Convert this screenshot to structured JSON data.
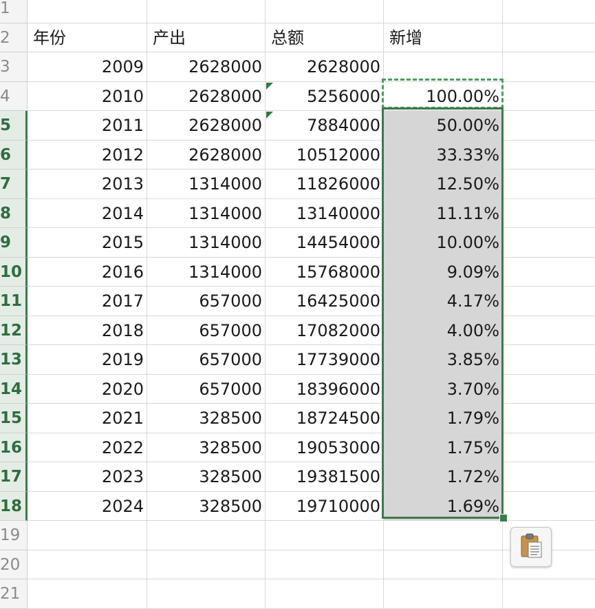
{
  "headers": [
    "年份",
    "产出",
    "总额",
    "新增"
  ],
  "rows": [
    {
      "n": "1",
      "year": "",
      "out": "",
      "total": "",
      "pct": ""
    },
    {
      "n": "2",
      "year": "年份",
      "out": "产出",
      "total": "总额",
      "pct": "新增"
    },
    {
      "n": "3",
      "year": "2009",
      "out": "2628000",
      "total": "2628000",
      "pct": ""
    },
    {
      "n": "4",
      "year": "2010",
      "out": "2628000",
      "total": "5256000",
      "pct": "100.00%"
    },
    {
      "n": "5",
      "year": "2011",
      "out": "2628000",
      "total": "7884000",
      "pct": "50.00%"
    },
    {
      "n": "6",
      "year": "2012",
      "out": "2628000",
      "total": "10512000",
      "pct": "33.33%"
    },
    {
      "n": "7",
      "year": "2013",
      "out": "1314000",
      "total": "11826000",
      "pct": "12.50%"
    },
    {
      "n": "8",
      "year": "2014",
      "out": "1314000",
      "total": "13140000",
      "pct": "11.11%"
    },
    {
      "n": "9",
      "year": "2015",
      "out": "1314000",
      "total": "14454000",
      "pct": "10.00%"
    },
    {
      "n": "10",
      "year": "2016",
      "out": "1314000",
      "total": "15768000",
      "pct": "9.09%"
    },
    {
      "n": "11",
      "year": "2017",
      "out": "657000",
      "total": "16425000",
      "pct": "4.17%"
    },
    {
      "n": "12",
      "year": "2018",
      "out": "657000",
      "total": "17082000",
      "pct": "4.00%"
    },
    {
      "n": "13",
      "year": "2019",
      "out": "657000",
      "total": "17739000",
      "pct": "3.85%"
    },
    {
      "n": "14",
      "year": "2020",
      "out": "657000",
      "total": "18396000",
      "pct": "3.70%"
    },
    {
      "n": "15",
      "year": "2021",
      "out": "328500",
      "total": "18724500",
      "pct": "1.79%"
    },
    {
      "n": "16",
      "year": "2022",
      "out": "328500",
      "total": "19053000",
      "pct": "1.75%"
    },
    {
      "n": "17",
      "year": "2023",
      "out": "328500",
      "total": "19381500",
      "pct": "1.72%"
    },
    {
      "n": "18",
      "year": "2024",
      "out": "328500",
      "total": "19710000",
      "pct": "1.69%"
    },
    {
      "n": "19",
      "year": "",
      "out": "",
      "total": "",
      "pct": ""
    },
    {
      "n": "20",
      "year": "",
      "out": "",
      "total": "",
      "pct": ""
    },
    {
      "n": "21",
      "year": "",
      "out": "",
      "total": "",
      "pct": ""
    }
  ],
  "paste_options": {
    "icon": "clipboard-icon"
  },
  "colors": {
    "selection": "#3a7a4c",
    "selected_fill": "#d6d6d6",
    "marquee": "#4f9a5c"
  }
}
